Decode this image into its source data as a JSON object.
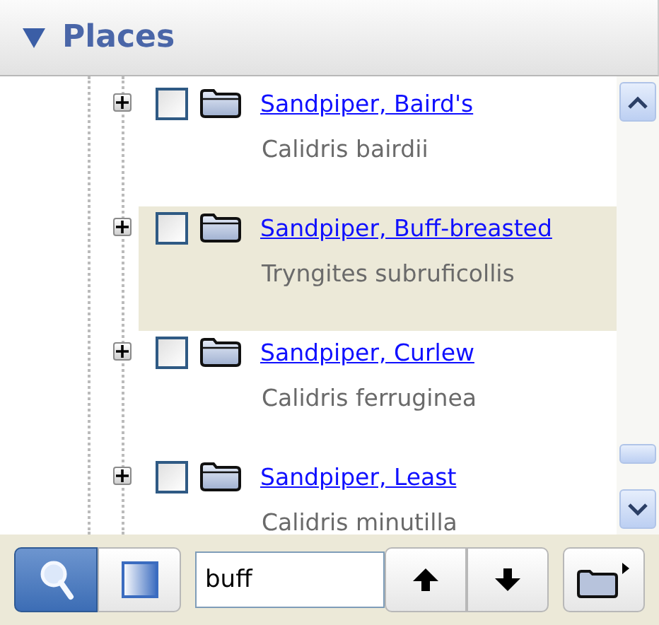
{
  "panel": {
    "title": "Places",
    "expanded": true
  },
  "tree": {
    "items": [
      {
        "name": "Sandpiper, Baird's",
        "latin": "Calidris bairdii",
        "selected": false,
        "checked": false,
        "expanded": false
      },
      {
        "name": "Sandpiper, Buff-breasted",
        "latin": "Tryngites subruficollis",
        "selected": true,
        "checked": false,
        "expanded": false
      },
      {
        "name": "Sandpiper, Curlew",
        "latin": "Calidris ferruginea",
        "selected": false,
        "checked": false,
        "expanded": false
      },
      {
        "name": "Sandpiper, Least",
        "latin": "Calidris minutilla",
        "selected": false,
        "checked": false,
        "expanded": false
      }
    ]
  },
  "toolbar": {
    "modes": [
      {
        "kind": "search",
        "selected": true
      },
      {
        "kind": "panel",
        "selected": false
      }
    ],
    "search": {
      "value": "buff"
    }
  }
}
